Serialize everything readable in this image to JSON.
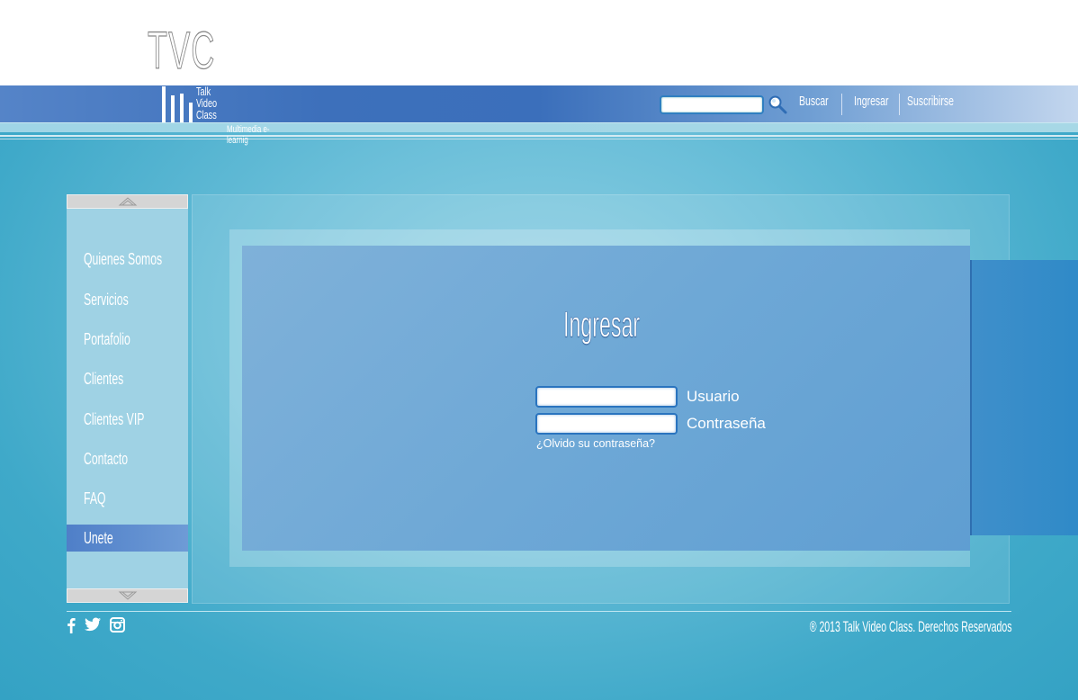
{
  "logo": {
    "initials": "TVC",
    "words": [
      "Talk",
      "Video",
      "Class"
    ],
    "tagline": "Multimedia e-learnig"
  },
  "header": {
    "search_placeholder": "",
    "search_icon": "magnifier-icon",
    "nav": [
      "Buscar",
      "Ingresar",
      "Suscribirse"
    ]
  },
  "sidebar": {
    "items": [
      {
        "label": "Quienes Somos",
        "active": false
      },
      {
        "label": "Servicios",
        "active": false
      },
      {
        "label": "Portafolio",
        "active": false
      },
      {
        "label": "Clientes",
        "active": false
      },
      {
        "label": "Clientes VIP",
        "active": false
      },
      {
        "label": "Contacto",
        "active": false
      },
      {
        "label": "FAQ",
        "active": false
      },
      {
        "label": "Unete",
        "active": true
      }
    ]
  },
  "login": {
    "title": "Ingresar",
    "username_label": "Usuario",
    "username_value": "",
    "password_label": "Contraseña",
    "password_value": "",
    "forgot": "¿Olvido su contraseña?"
  },
  "footer": {
    "social": [
      "facebook-icon",
      "twitter-icon",
      "instagram-icon"
    ],
    "copyright": "® 2013 Talk Video Class. Derechos Reservados"
  },
  "colors": {
    "header_blue": "#3d70bb",
    "page_background": "#6bbfd9",
    "content_panel": "#6ea8d6",
    "active_menu": "#5b88cc"
  }
}
